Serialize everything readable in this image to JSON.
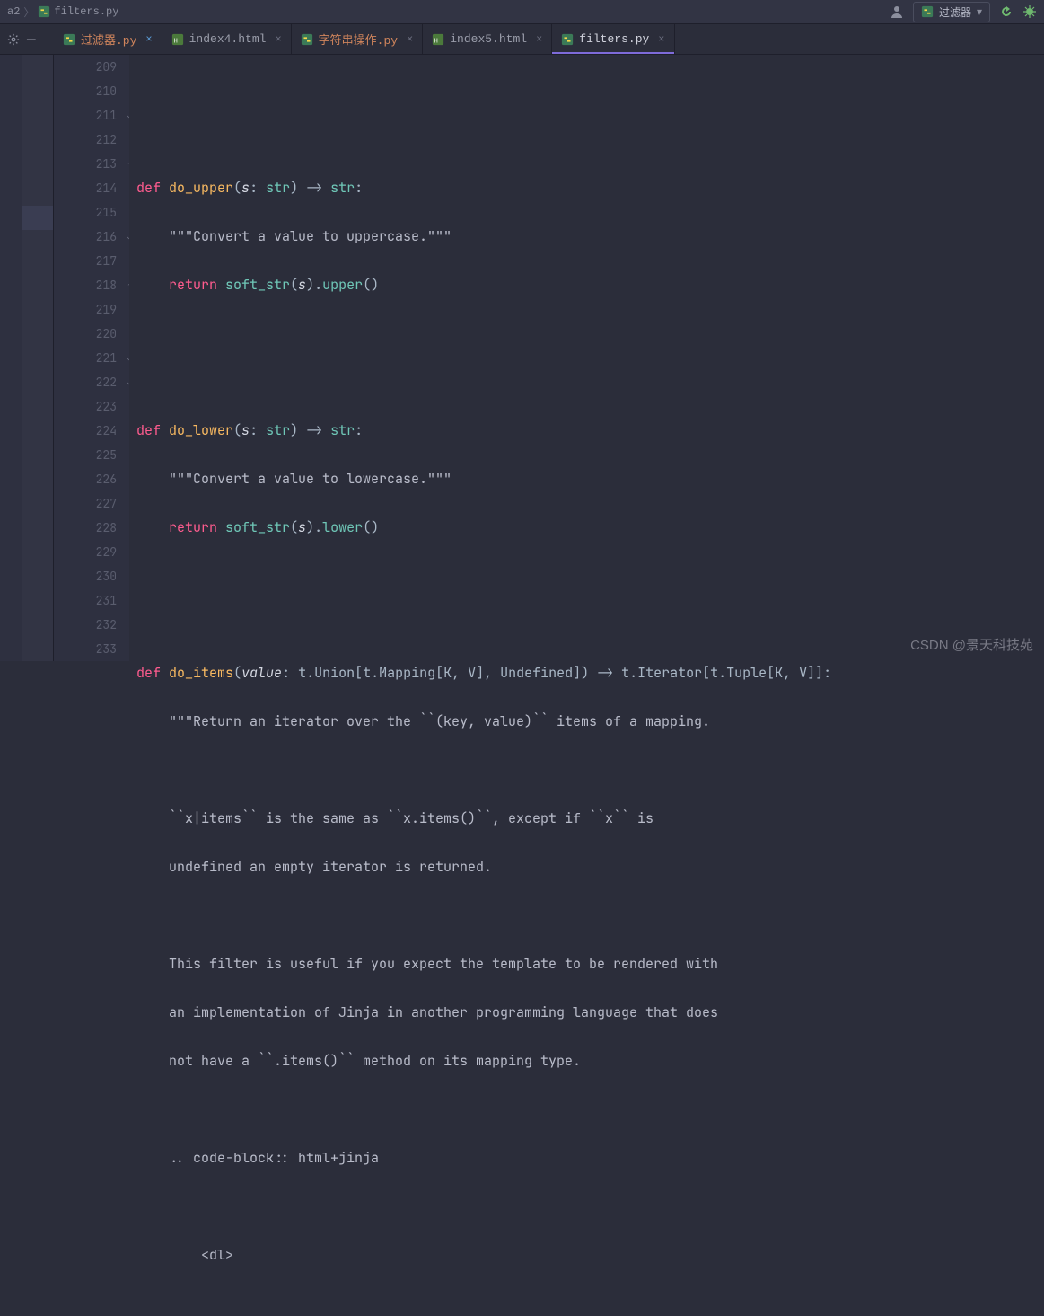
{
  "breadcrumb": {
    "parent": "a2",
    "file": "filters.py"
  },
  "run_config": {
    "label": "过滤器"
  },
  "tabs": [
    {
      "label": "过滤器.py",
      "type": "py",
      "active": false,
      "modified": true,
      "orange": true
    },
    {
      "label": "index4.html",
      "type": "html",
      "active": false,
      "modified": false,
      "orange": false
    },
    {
      "label": "字符串操作.py",
      "type": "py",
      "active": false,
      "modified": false,
      "orange": true
    },
    {
      "label": "index5.html",
      "type": "html",
      "active": false,
      "modified": false,
      "orange": false
    },
    {
      "label": "filters.py",
      "type": "py",
      "active": true,
      "modified": false,
      "orange": false
    }
  ],
  "gutter": {
    "start": 209,
    "end": 233
  },
  "code_lines": {
    "l209": "",
    "l210": "",
    "l211_def": "def ",
    "l211_fn": "do_upper",
    "l211_sig_a": "(",
    "l211_param": "s",
    "l211_sig_b": ": ",
    "l211_type": "str",
    "l211_sig_c": ") -> ",
    "l211_ret": "str",
    "l211_sig_d": ":",
    "l212": "    \"\"\"Convert a value to uppercase.\"\"\"",
    "l213_ret": "    return ",
    "l213_call": "soft_str",
    "l213_a": "(",
    "l213_p": "s",
    "l213_b": ").",
    "l213_m": "upper",
    "l213_c": "()",
    "l214": "",
    "l215": "",
    "l216_def": "def ",
    "l216_fn": "do_lower",
    "l216_sig_a": "(",
    "l216_param": "s",
    "l216_sig_b": ": ",
    "l216_type": "str",
    "l216_sig_c": ") -> ",
    "l216_ret": "str",
    "l216_sig_d": ":",
    "l217": "    \"\"\"Convert a value to lowercase.\"\"\"",
    "l218_ret": "    return ",
    "l218_call": "soft_str",
    "l218_a": "(",
    "l218_p": "s",
    "l218_b": ").",
    "l218_m": "lower",
    "l218_c": "()",
    "l219": "",
    "l220": "",
    "l221_def": "def ",
    "l221_fn": "do_items",
    "l221_rest": "(value: t.Union[t.Mapping[K, V], Undefined]) -> t.Iterator[t.Tuple[K, V]]:",
    "l222": "    \"\"\"Return an iterator over the ``(key, value)`` items of a mapping.",
    "l223": "",
    "l224": "    ``x|items`` is the same as ``x.items()``, except if ``x`` is",
    "l225": "    undefined an empty iterator is returned.",
    "l226": "",
    "l227": "    This filter is useful if you expect the template to be rendered with",
    "l228": "    an implementation of Jinja in another programming language that does",
    "l229": "    not have a ``.items()`` method on its mapping type.",
    "l230": "",
    "l231": "    .. code-block:: html+jinja",
    "l232": "",
    "l233": "        <dl>"
  },
  "watermark": "CSDN @景天科技苑"
}
